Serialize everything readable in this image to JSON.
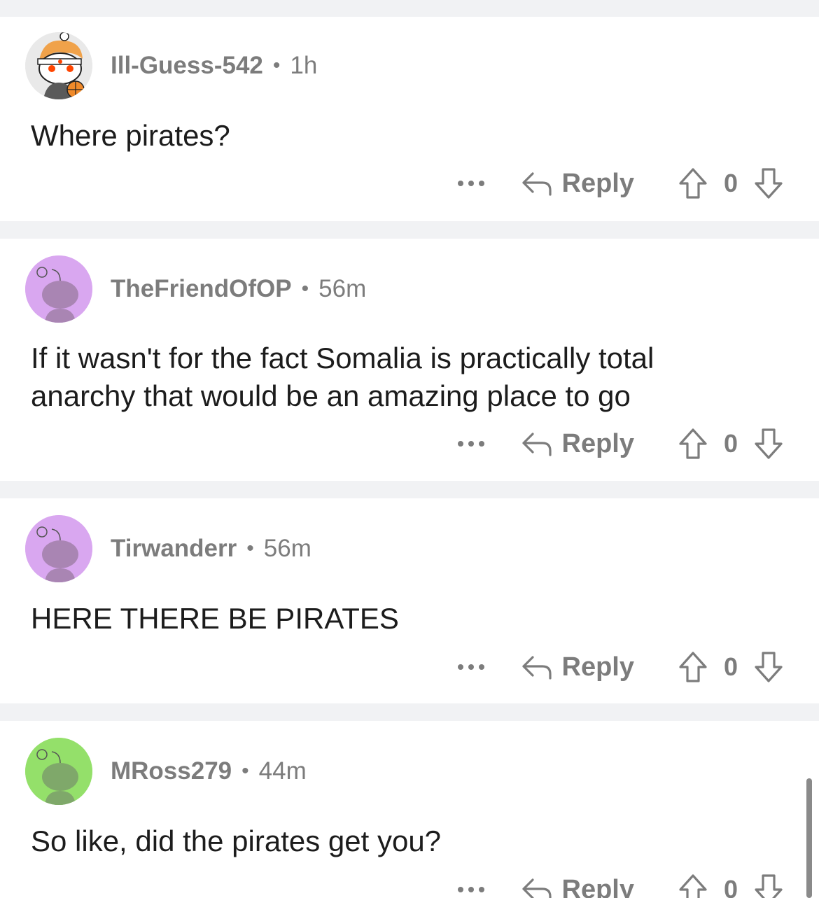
{
  "comments": [
    {
      "username": "Ill-Guess-542",
      "separator": "•",
      "age": "1h",
      "body": "Where pirates?",
      "more_label": "•••",
      "reply_label": "Reply",
      "score": "0",
      "avatar_icon": "snoo-avatar-custom",
      "avatar_color": "#e9e9e9"
    },
    {
      "username": "TheFriendOfOP",
      "separator": "•",
      "age": "56m",
      "body": "If it wasn't for the fact Somalia is practically total anarchy that would be an amazing place to go",
      "more_label": "•••",
      "reply_label": "Reply",
      "score": "0",
      "avatar_icon": "snoo-avatar-default",
      "avatar_color": "#d9a7f0"
    },
    {
      "username": "Tirwanderr",
      "separator": "•",
      "age": "56m",
      "body": "HERE THERE BE PIRATES",
      "more_label": "•••",
      "reply_label": "Reply",
      "score": "0",
      "avatar_icon": "snoo-avatar-default",
      "avatar_color": "#d9a7f0"
    },
    {
      "username": "MRoss279",
      "separator": "•",
      "age": "44m",
      "body": "So like, did the pirates get you?",
      "more_label": "•••",
      "reply_label": "Reply",
      "score": "0",
      "avatar_icon": "snoo-avatar-default",
      "avatar_color": "#94e06a"
    }
  ],
  "colors": {
    "background": "#f1f2f4",
    "card": "#ffffff",
    "muted_text": "#7c7c7c",
    "body_text": "#1c1c1c"
  }
}
